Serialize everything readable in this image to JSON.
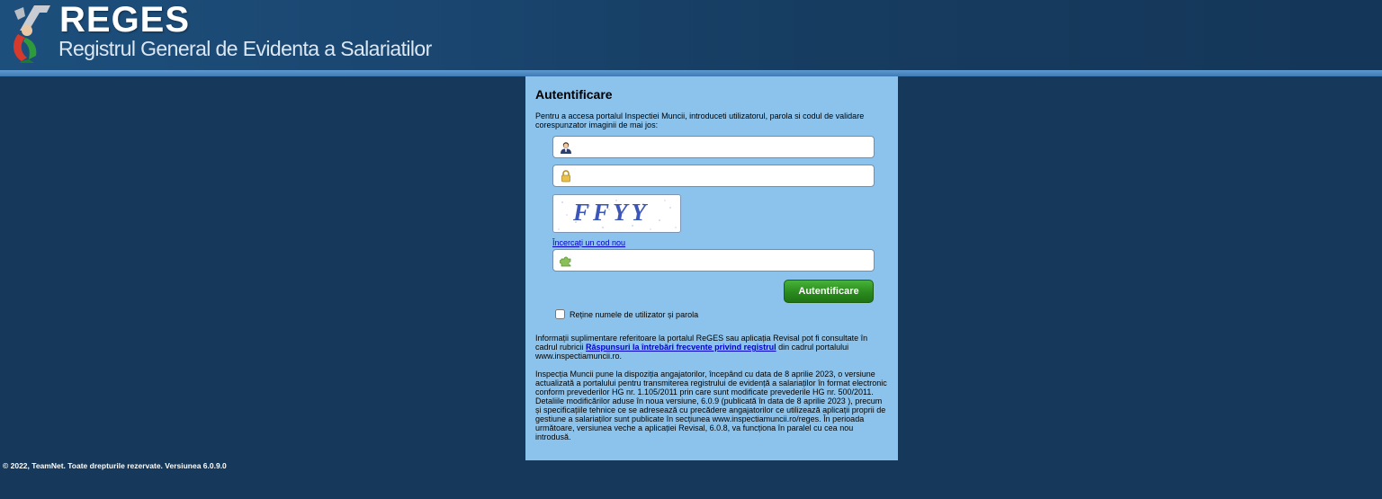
{
  "header": {
    "logo_title": "REGES",
    "logo_subtitle": "Registrul General de Evidenta a Salariatilor"
  },
  "login": {
    "title": "Autentificare",
    "intro": "Pentru a accesa portalul Inspectiei Muncii, introduceti utilizatorul, parola si codul de validare corespunzator imaginii de mai jos:",
    "username_icon": "user-icon",
    "password_icon": "lock-icon",
    "captcha_icon": "puzzle-icon",
    "username_value": "",
    "password_value": "",
    "captcha_value": "",
    "captcha_image_text": "FFYY",
    "new_code_link": "Încercați un cod nou",
    "submit_label": "Autentificare",
    "remember_label": "Reține numele de utilizator și parola",
    "remember_checked": false
  },
  "info": {
    "para1_before": "Informații suplimentare referitoare la portalul ReGES sau aplicația Revisal pot fi consultate în cadrul rubricii ",
    "para1_link": "Răspunsuri la întrebări frecvente privind registrul",
    "para1_after": " din cadrul portalului www.inspectiamuncii.ro.",
    "para2": "Inspecția Muncii pune la dispoziția angajatorilor, începând cu data de 8 aprilie 2023, o versiune actualizată a portalului pentru transmiterea registrului de evidență a salariaților în format electronic conform prevederilor HG nr. 1.105/2011 prin care sunt modificate prevederile HG nr. 500/2011.",
    "para3": "Detaliile modificărilor aduse în noua versiune, 6.0.9 (publicată în data de 8 aprilie 2023 ), precum și specificațiile tehnice ce se adresează cu precădere angajatorilor ce utilizează aplicații proprii de gestiune a salariaților sunt publicate în secțiunea www.inspectiamuncii.ro/reges. În perioada următoare, versiunea veche a aplicației Revisal, 6.0.8, va funcționa în paralel cu cea nou introdusă."
  },
  "footer": {
    "text": "© 2022, TeamNet. Toate drepturile rezervate. Versiunea 6.0.9.0"
  },
  "colors": {
    "background": "#16385a",
    "panel": "#8cc3ec",
    "button": "#2a8a1e",
    "link": "#0000cc"
  }
}
